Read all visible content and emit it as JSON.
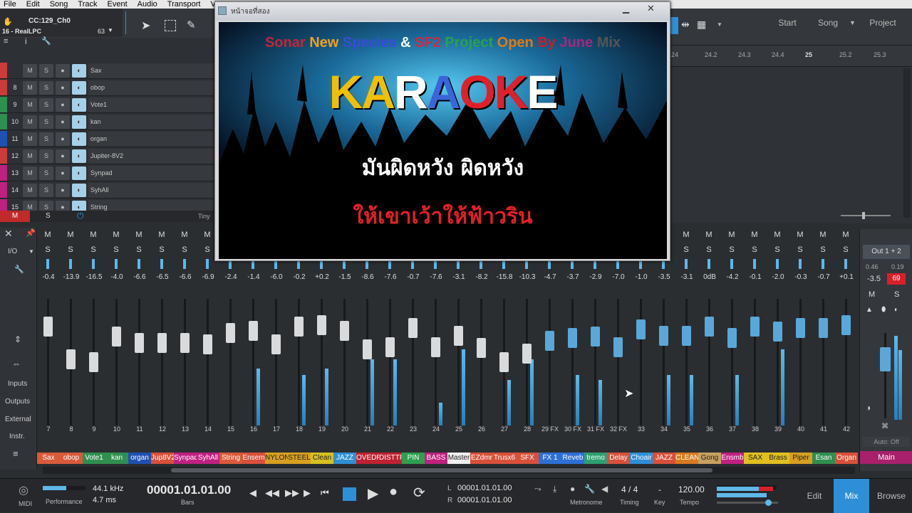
{
  "menu": [
    "File",
    "Edit",
    "Song",
    "Track",
    "Event",
    "Audio",
    "Transport",
    "V"
  ],
  "toolbar": {
    "cc_label": "CC:129_Ch0",
    "device_label": "16 - RealLPC",
    "zoom_value": "63",
    "start_tab": "Start",
    "song_tab": "Song",
    "project_tab": "Project"
  },
  "ruler": [
    "24",
    "24.2",
    "24.3",
    "24.4",
    "25",
    "25.2",
    "25.3"
  ],
  "tracks": [
    {
      "num": "",
      "name": "Sax",
      "color": "#cc3a3a"
    },
    {
      "num": "8",
      "name": "obop",
      "color": "#cc3a3a"
    },
    {
      "num": "9",
      "name": "Vote1",
      "color": "#2f8f4f"
    },
    {
      "num": "10",
      "name": "kan",
      "color": "#2f8f4f"
    },
    {
      "num": "11",
      "name": "organ",
      "color": "#2050b0"
    },
    {
      "num": "12",
      "name": "Jupiter-8V2",
      "color": "#cc3a3a"
    },
    {
      "num": "13",
      "name": "Synpad",
      "color": "#c02080"
    },
    {
      "num": "14",
      "name": "SyhAll",
      "color": "#c02080"
    },
    {
      "num": "15",
      "name": "String",
      "color": "#c02080"
    }
  ],
  "track_footer": {
    "m": "M",
    "s": "S",
    "zoom": "Tiny"
  },
  "karaoke": {
    "title": "หน้าจอที่สอง",
    "headline": [
      "Sonar ",
      "New ",
      "Species ",
      "& ",
      "SF2 ",
      "Project ",
      "Open ",
      "By ",
      "June ",
      "Mix"
    ],
    "logo": [
      "K",
      "A",
      "R",
      "A",
      "O",
      "K",
      "E"
    ],
    "line1": "มันผิดหวัง ผิดหวัง",
    "line2": "ให้เขาเว้าให้ฟ้าวริน"
  },
  "colors": {
    "accent": "#2e8fd6",
    "record": "#e03a3a",
    "headline": [
      "#c0263a",
      "#f0a020",
      "#3a4bd8",
      "#ffffff",
      "#d02a40",
      "#2aa050",
      "#e07a18",
      "#c21f30",
      "#a02a80",
      "#555555"
    ],
    "logo": [
      "#f0c000",
      "#f0c000",
      "#ffffff",
      "#3a66d8",
      "#e0202a",
      "#e0202a",
      "#ffffff"
    ]
  },
  "mixer": {
    "io_label": "I/O",
    "side": [
      "Inputs",
      "Outputs",
      "External",
      "Instr."
    ],
    "channels": [
      {
        "vol": "-0.4",
        "num": "7",
        "label": "Sax",
        "color": "#d85a3a",
        "level": 0.78,
        "meter": 0
      },
      {
        "vol": "-13.9",
        "num": "8",
        "label": "obop",
        "color": "#d85a3a",
        "level": 0.52,
        "meter": 0
      },
      {
        "vol": "-16.5",
        "num": "9",
        "label": "Vote1",
        "color": "#2f8f4f",
        "level": 0.5,
        "meter": 0
      },
      {
        "vol": "-4.0",
        "num": "10",
        "label": "kan",
        "color": "#2f8f4f",
        "level": 0.7,
        "meter": 0
      },
      {
        "vol": "-6.6",
        "num": "11",
        "label": "organ",
        "color": "#2050b0",
        "level": 0.65,
        "meter": 0
      },
      {
        "vol": "-6.5",
        "num": "12",
        "label": "Jup8V2",
        "color": "#d8503a",
        "level": 0.65,
        "meter": 0
      },
      {
        "vol": "-6.6",
        "num": "13",
        "label": "Synpad",
        "color": "#c02080",
        "level": 0.65,
        "meter": 0
      },
      {
        "vol": "-6.9",
        "num": "14",
        "label": "SyhAll",
        "color": "#c02080",
        "level": 0.64,
        "meter": 0
      },
      {
        "vol": "-2.4",
        "num": "15",
        "label": "String",
        "color": "#d85a3a",
        "level": 0.73,
        "meter": 0
      },
      {
        "vol": "-1.4",
        "num": "16",
        "label": "Ensem",
        "color": "#d8503a",
        "level": 0.75,
        "meter": 0.45
      },
      {
        "vol": "-6.0",
        "num": "17",
        "label": "NYLON",
        "color": "#d8a020",
        "level": 0.64,
        "meter": 0
      },
      {
        "vol": "-0.2",
        "num": "18",
        "label": "STEEL",
        "color": "#d8a020",
        "level": 0.78,
        "meter": 0.4
      },
      {
        "vol": "+0.2",
        "num": "19",
        "label": "Clean",
        "color": "#d8c020",
        "level": 0.79,
        "meter": 0.45
      },
      {
        "vol": "-1.5",
        "num": "20",
        "label": "JAZZ",
        "color": "#2e8fd6",
        "level": 0.75,
        "meter": 0
      },
      {
        "vol": "-8.6",
        "num": "21",
        "label": "OVEDRI",
        "color": "#c02030",
        "level": 0.6,
        "meter": 0.52
      },
      {
        "vol": "-7.6",
        "num": "22",
        "label": "DISTTF",
        "color": "#c02030",
        "level": 0.62,
        "meter": 0.52
      },
      {
        "vol": "-0.7",
        "num": "23",
        "label": "PIN",
        "color": "#2f9f4f",
        "level": 0.77,
        "meter": 0
      },
      {
        "vol": "-7.6",
        "num": "24",
        "label": "BASS",
        "color": "#c02080",
        "level": 0.62,
        "meter": 0.18
      },
      {
        "vol": "-3.1",
        "num": "25",
        "label": "Master",
        "color": "#f0f0f0",
        "level": 0.71,
        "meter": 0.6
      },
      {
        "vol": "-8.2",
        "num": "26",
        "label": "EZdmr",
        "color": "#d8503a",
        "level": 0.61,
        "meter": 0
      },
      {
        "vol": "-15.8",
        "num": "27",
        "label": "Trusx6",
        "color": "#d8503a",
        "level": 0.5,
        "meter": 0.36
      },
      {
        "vol": "-10.3",
        "num": "28",
        "label": "SFX",
        "color": "#d8503a",
        "level": 0.57,
        "meter": 0.52
      },
      {
        "vol": "-4.7",
        "num": "29 FX",
        "label": "FX 1",
        "color": "#2e6fd6",
        "level": 0.67,
        "meter": 0
      },
      {
        "vol": "-3.7",
        "num": "30 FX",
        "label": "Reveb",
        "color": "#2e6fd6",
        "level": 0.69,
        "meter": 0.4
      },
      {
        "vol": "-2.9",
        "num": "31 FX",
        "label": "tremo",
        "color": "#2e9f6f",
        "level": 0.7,
        "meter": 0.36
      },
      {
        "vol": "-7.0",
        "num": "32 FX",
        "label": "Delay",
        "color": "#d8503a",
        "level": 0.62,
        "meter": 0
      },
      {
        "vol": "-1.0",
        "num": "33",
        "label": "Choair",
        "color": "#2e8fd6",
        "level": 0.76,
        "meter": 0
      },
      {
        "vol": "-3.5",
        "num": "34",
        "label": "JAZZ",
        "color": "#d8503a",
        "level": 0.71,
        "meter": 0.4
      },
      {
        "vol": "-3.1",
        "num": "35",
        "label": "CLEAN",
        "color": "#d87a20",
        "level": 0.71,
        "meter": 0.4
      },
      {
        "vol": "0dB",
        "num": "36",
        "label": "Gong",
        "color": "#c8a060",
        "level": 0.78,
        "meter": 0
      },
      {
        "vol": "-4.2",
        "num": "37",
        "label": "Ensmb",
        "color": "#c02080",
        "level": 0.69,
        "meter": 0.4
      },
      {
        "vol": "-0.1",
        "num": "38",
        "label": "SAX",
        "color": "#e0c020",
        "level": 0.78,
        "meter": 0
      },
      {
        "vol": "-2.0",
        "num": "39",
        "label": "Brass",
        "color": "#e0c020",
        "level": 0.74,
        "meter": 0.6
      },
      {
        "vol": "-0.3",
        "num": "40",
        "label": "Piper",
        "color": "#d8a020",
        "level": 0.77,
        "meter": 0
      },
      {
        "vol": "-0.7",
        "num": "41",
        "label": "Esan",
        "color": "#2f8f4f",
        "level": 0.77,
        "meter": 0
      },
      {
        "vol": "+0.1",
        "num": "42",
        "label": "Organ",
        "color": "#d8503a",
        "level": 0.79,
        "meter": 0
      }
    ],
    "main": {
      "output": "Out 1 + 2",
      "peak_l": "0.46",
      "peak_r": "0.19",
      "vol": "-3.5",
      "peak": "69",
      "auto": "Auto: Off",
      "label": "Main"
    }
  },
  "transport": {
    "midi_label": "MIDI",
    "sample_rate": "44.1 kHz",
    "perf_label": "Performance",
    "latency": "4.7 ms",
    "position": "00001.01.01.00",
    "position_unit": "Bars",
    "loop_l": "00001.01.01.00",
    "loop_r": "00001.01.01.00",
    "l_label": "L",
    "r_label": "R",
    "metronome": "Metronome",
    "timing": "Timing",
    "timesig": "4 / 4",
    "key_value": "-",
    "key_label": "Key",
    "tempo": "120.00",
    "tempo_label": "Tempo",
    "edit": "Edit",
    "mix": "Mix",
    "browse": "Browse"
  }
}
